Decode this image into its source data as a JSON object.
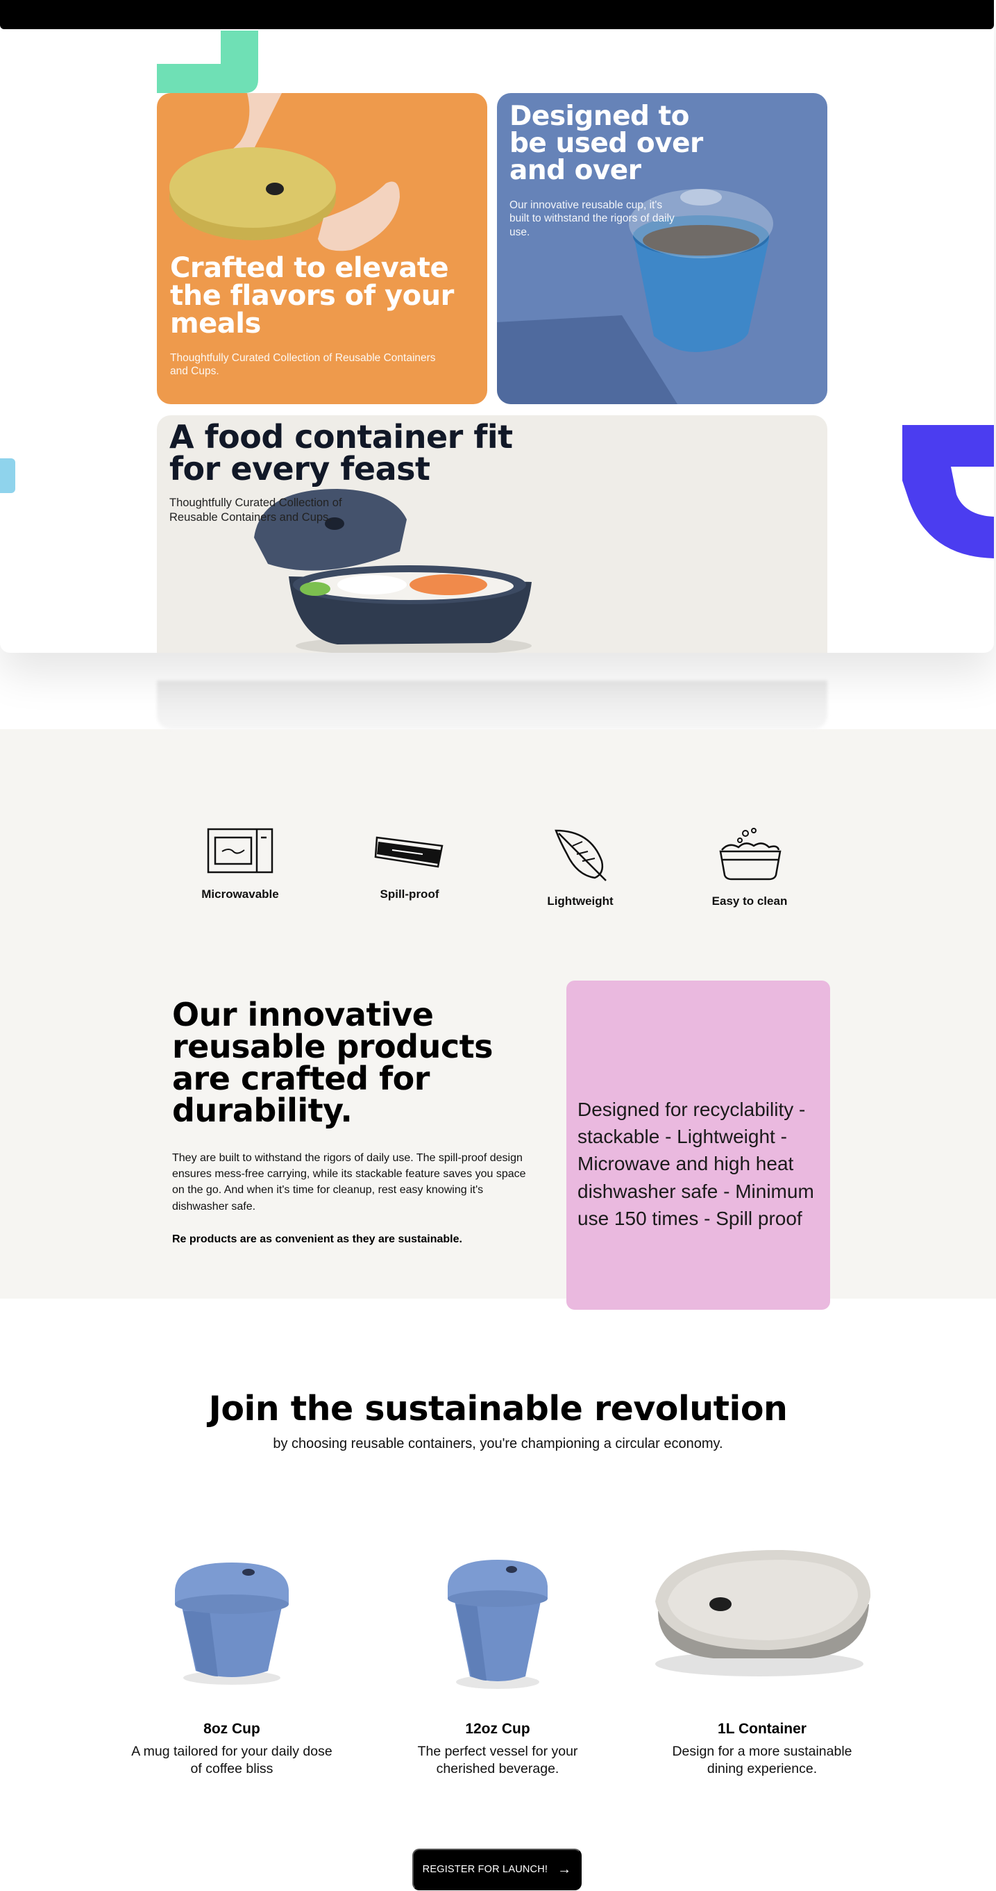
{
  "hero": {
    "cards": {
      "orange": {
        "title": "Crafted to elevate the flavors of your meals",
        "subtitle": "Thoughtfully Curated Collection of Reusable Containers and Cups."
      },
      "blue": {
        "title": "Designed to be used over and over",
        "subtitle": "Our innovative reusable cup, it's built to withstand the rigors of daily use."
      },
      "cream": {
        "title": "A food container fit for every feast",
        "subtitle": "Thoughtfully Curated Collection of Reusable Containers and Cups."
      }
    }
  },
  "features": [
    {
      "label": "Microwavable",
      "icon": "microwave-icon"
    },
    {
      "label": "Spill-proof",
      "icon": "lid-icon"
    },
    {
      "label": "Lightweight",
      "icon": "feather-icon"
    },
    {
      "label": "Easy to clean",
      "icon": "washing-bowl-icon"
    }
  ],
  "durability": {
    "title": "Our innovative reusable products are crafted for durability.",
    "body": "They are built to withstand the rigors of daily use. The spill-proof design ensures mess-free carrying, while its stackable feature saves you space on the go. And when it's time for cleanup, rest easy knowing it's dishwasher safe.",
    "strong": "Re products are as convenient as they are sustainable.",
    "card_text": "Designed for recyclability - stackable - Lightweight - Microwave and high heat dishwasher safe - Minimum use 150 times - Spill proof"
  },
  "revolution": {
    "title": "Join the sustainable revolution",
    "subtitle": "by choosing reusable containers, you're championing a circular economy."
  },
  "products": [
    {
      "name": "8oz Cup",
      "description": "A mug tailored for your daily dose of coffee bliss"
    },
    {
      "name": "12oz Cup",
      "description": "The perfect vessel for your cherished beverage."
    },
    {
      "name": "1L Container",
      "description": "Design for a more sustainable dining experience."
    }
  ],
  "cta": {
    "label": "REGISTER FOR LAUNCH!"
  },
  "colors": {
    "orange_card": "#ee9a4c",
    "blue_card": "#6683b8",
    "cream_card": "#efede8",
    "pink_card": "#eab9df",
    "product_blue": "#6f8fc8",
    "accent_indigo": "#4b3df0",
    "accent_green": "#6fe0b5"
  }
}
